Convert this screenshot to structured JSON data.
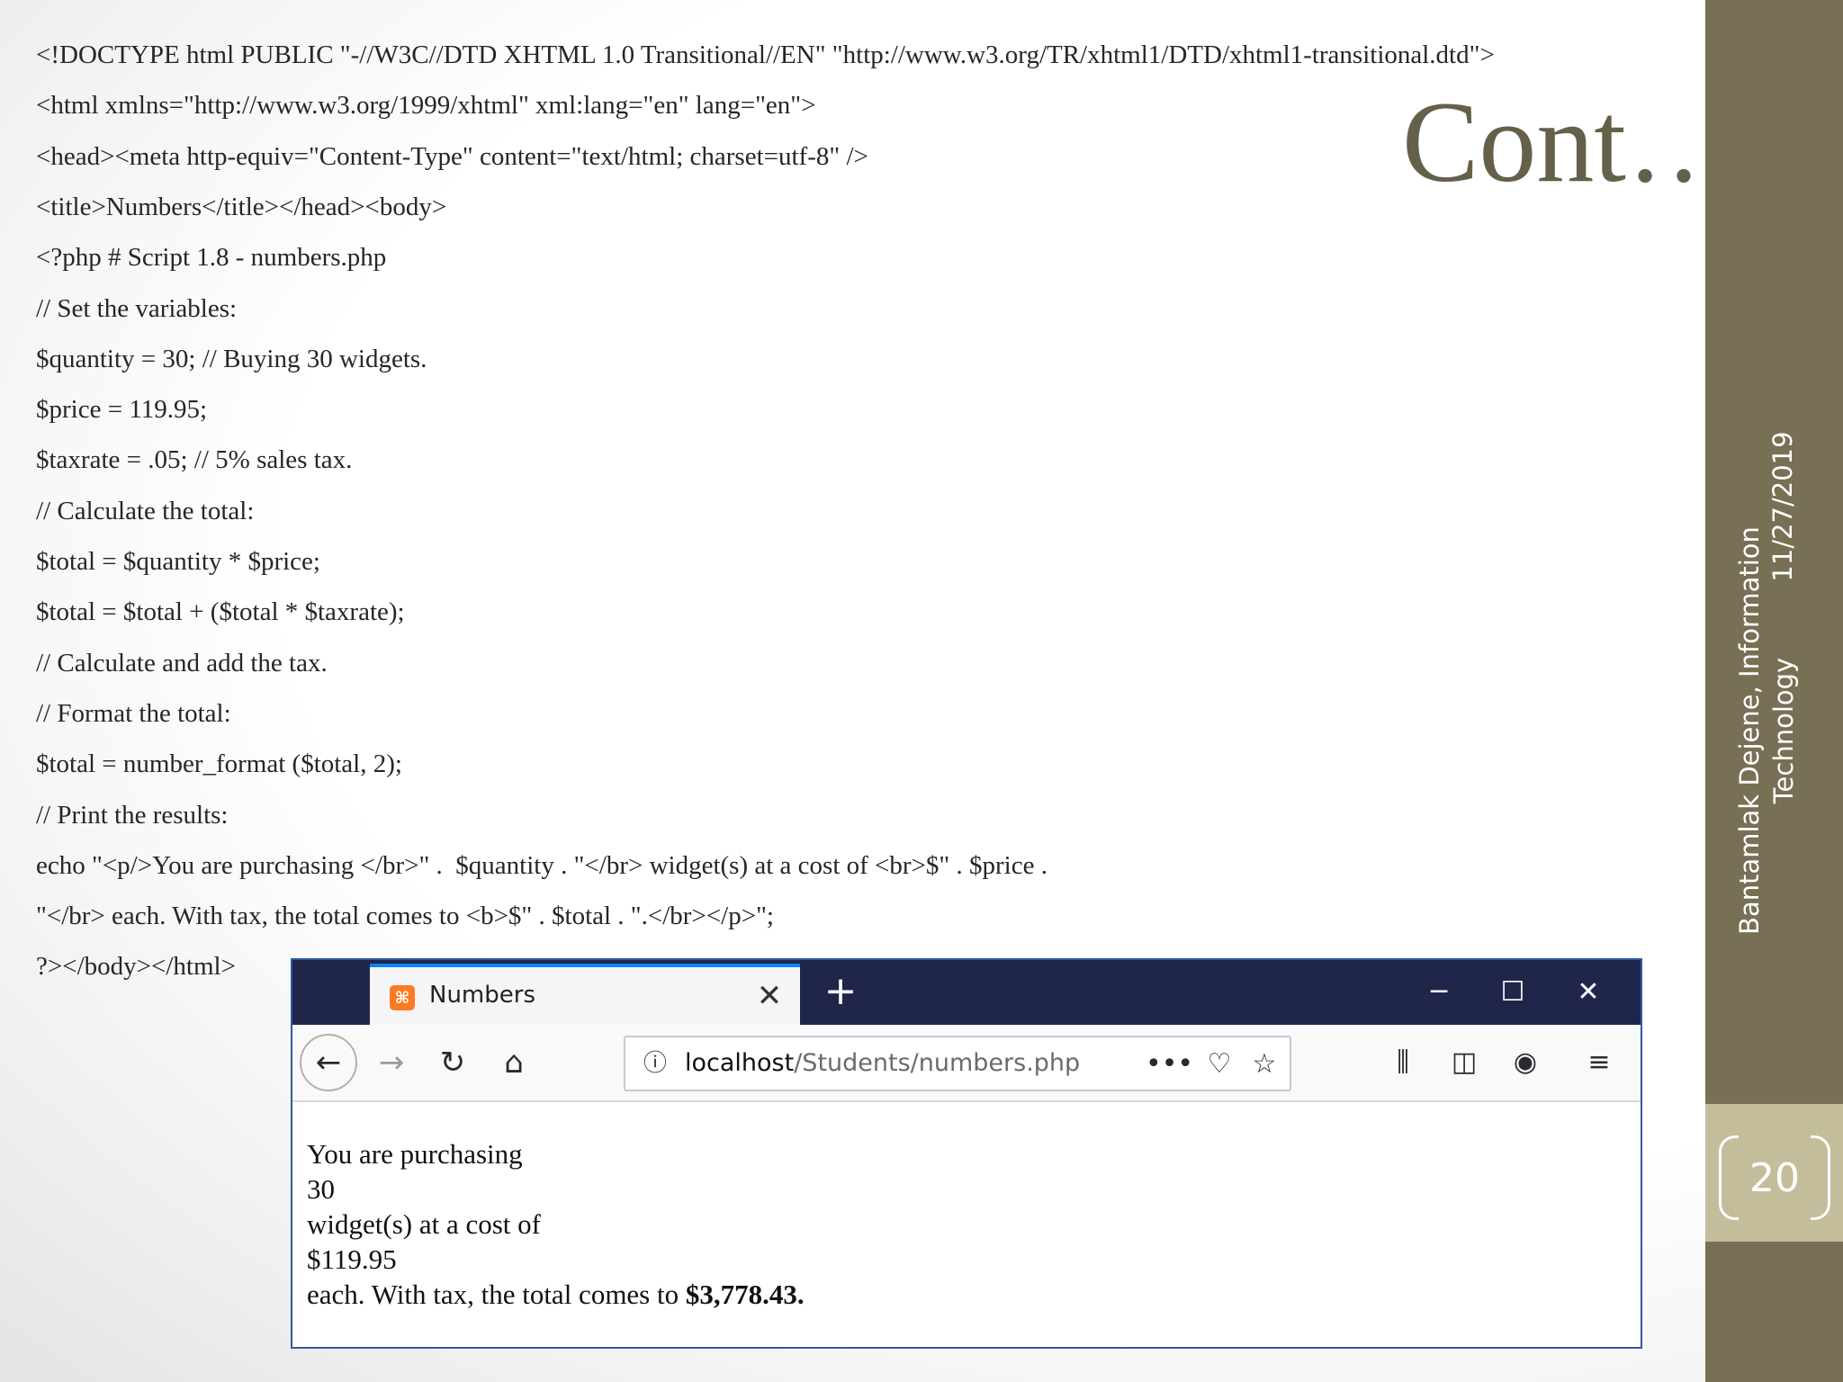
{
  "slide": {
    "title": "Cont…",
    "date": "11/27/2019",
    "author_line1": "Bantamlak Dejene, Information",
    "author_line2": "Technology",
    "page_number": "20",
    "code_lines": [
      "<!DOCTYPE html PUBLIC \"-//W3C//DTD XHTML 1.0 Transitional//EN\" \"http://www.w3.org/TR/xhtml1/DTD/xhtml1-transitional.dtd\">",
      "<html xmlns=\"http://www.w3.org/1999/xhtml\" xml:lang=\"en\" lang=\"en\">",
      "<head><meta http-equiv=\"Content-Type\" content=\"text/html; charset=utf-8\" />",
      "<title>Numbers</title></head><body>",
      "<?php # Script 1.8 - numbers.php",
      "// Set the variables:",
      "$quantity = 30; // Buying 30 widgets.",
      "$price = 119.95;",
      "$taxrate = .05; // 5% sales tax.",
      "// Calculate the total:",
      "$total = $quantity * $price;",
      "$total = $total + ($total * $taxrate);",
      "// Calculate and add the tax.",
      "// Format the total:",
      "$total = number_format ($total, 2);",
      "// Print the results:",
      "echo \"<p/>You are purchasing </br>\" .  $quantity . \"</br> widget(s) at a cost of <br>$\" . $price .",
      "\"</br> each. With tax, the total comes to <b>$\" . $total . \".</br></p>\";",
      "?></body></html>"
    ]
  },
  "browser": {
    "tab_title": "Numbers",
    "url_host": "localhost",
    "url_path": "/Students/numbers.php",
    "icons": {
      "favicon": "xampp-icon",
      "close_tab": "close-icon",
      "new_tab": "plus-icon",
      "minimize": "minimize-icon",
      "maximize": "maximize-icon",
      "close_window": "close-icon",
      "back": "back-arrow-icon",
      "forward": "forward-arrow-icon",
      "reload": "reload-icon",
      "home": "home-icon",
      "info": "info-icon",
      "more": "more-icon",
      "pocket": "pocket-icon",
      "bookmark": "star-icon",
      "library": "library-icon",
      "sidebar": "sidebar-icon",
      "account": "account-icon",
      "menu": "hamburger-menu-icon"
    },
    "content": {
      "line1": "You are purchasing",
      "line2": "30",
      "line3": "widget(s) at a cost of",
      "line4": "$119.95",
      "line5_prefix": "each. With tax, the total comes to ",
      "line5_total": "$3,778.43."
    }
  },
  "colors": {
    "title": "#65604a",
    "sidebar": "#777054",
    "page_box": "#c3bd9b",
    "tabbar": "#20264a",
    "tab_accent": "#0a84ff"
  }
}
